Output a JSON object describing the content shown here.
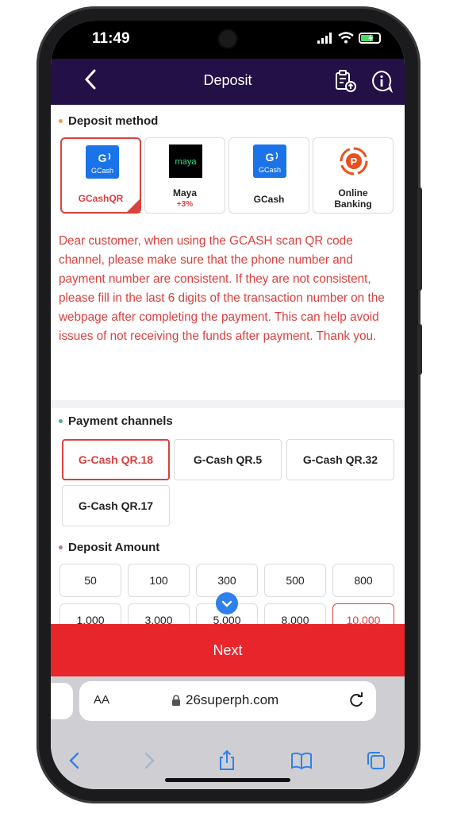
{
  "status_bar": {
    "time": "11:49"
  },
  "header": {
    "title": "Deposit"
  },
  "deposit_method": {
    "title": "Deposit method",
    "methods": [
      {
        "name": "GCashQR",
        "logo_text": "GCash",
        "active": true
      },
      {
        "name": "Maya",
        "bonus": "+3%",
        "logo_text": "maya",
        "active": false
      },
      {
        "name": "GCash",
        "logo_text": "GCash",
        "active": false
      },
      {
        "name_line1": "Online",
        "name_line2": "Banking",
        "active": false
      }
    ],
    "notice": "Dear customer, when using the GCASH scan QR code channel, please make sure that the phone number and payment number are consistent. If they are not consistent, please fill in the last 6 digits of the transaction number on the webpage after completing the payment. This can help avoid issues of not receiving the funds after payment. Thank you."
  },
  "payment_channels": {
    "title": "Payment channels",
    "channels": [
      "G-Cash QR.18",
      "G-Cash QR.5",
      "G-Cash QR.32",
      "G-Cash QR.17"
    ],
    "selected": "G-Cash QR.18"
  },
  "deposit_amount": {
    "title": "Deposit Amount",
    "amounts": [
      "50",
      "100",
      "300",
      "500",
      "800",
      "1,000",
      "3,000",
      "5,000",
      "8,000",
      "10,000"
    ],
    "selected": "10,000"
  },
  "next_button": {
    "label": "Next"
  },
  "browser": {
    "aa_label": "AA",
    "url": "26superph.com"
  },
  "colors": {
    "header_bg": "#221047",
    "accent_red": "#d9413f",
    "next_bg": "#e8252a",
    "gcash_blue": "#1a73e8",
    "maya_green": "#2de08a"
  }
}
